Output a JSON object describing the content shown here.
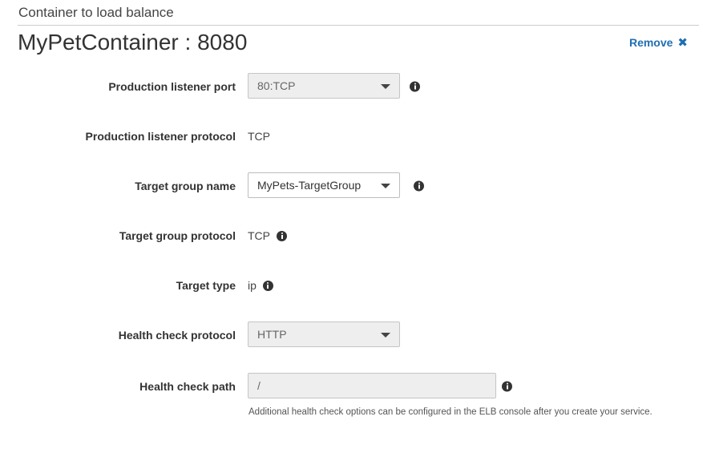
{
  "section": {
    "title": "Container to load balance"
  },
  "container": {
    "title": "MyPetContainer : 8080",
    "remove_label": "Remove"
  },
  "fields": {
    "production_listener_port": {
      "label": "Production listener port",
      "value": "80:TCP"
    },
    "production_listener_protocol": {
      "label": "Production listener protocol",
      "value": "TCP"
    },
    "target_group_name": {
      "label": "Target group name",
      "value": "MyPets-TargetGroup"
    },
    "target_group_protocol": {
      "label": "Target group protocol",
      "value": "TCP"
    },
    "target_type": {
      "label": "Target type",
      "value": "ip"
    },
    "health_check_protocol": {
      "label": "Health check protocol",
      "value": "HTTP"
    },
    "health_check_path": {
      "label": "Health check path",
      "value": "/",
      "help": "Additional health check options can be configured in the ELB console after you create your service."
    }
  },
  "icons": {
    "info": "info-icon",
    "remove": "close-icon",
    "dropdown": "caret-down-icon"
  },
  "colors": {
    "link": "#1f6eb3",
    "disabled_bg": "#eeeeee",
    "border": "#c5c5c5"
  }
}
